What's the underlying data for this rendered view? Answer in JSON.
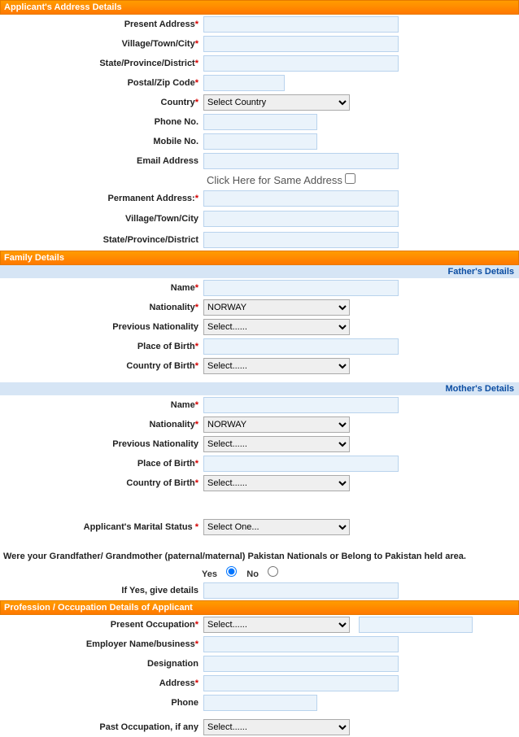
{
  "sections": {
    "address": {
      "header": "Applicant's Address Details",
      "present_address": "Present Address",
      "village": "Village/Town/City",
      "state": "State/Province/District",
      "postal": "Postal/Zip Code",
      "country": "Country",
      "phone": "Phone No.",
      "mobile": "Mobile No.",
      "email": "Email Address",
      "same_address_text": "Click Here for Same Address",
      "permanent_address": "Permanent Address:",
      "perm_village": "Village/Town/City",
      "perm_state": "State/Province/District",
      "country_selected": "Select Country"
    },
    "family": {
      "header": "Family Details",
      "fathers_details": "Father's Details",
      "mothers_details": "Mother's Details",
      "name": "Name",
      "nationality": "Nationality",
      "prev_nationality": "Previous Nationality",
      "place_of_birth": "Place of Birth",
      "country_of_birth": "Country of Birth",
      "nationality_selected": "NORWAY",
      "select_placeholder": "Select......"
    },
    "marital": {
      "label": "Applicant's Marital Status",
      "selected": "Select One..."
    },
    "pakistan": {
      "question": "Were your Grandfather/ Grandmother (paternal/maternal) Pakistan Nationals or Belong to Pakistan held area.",
      "yes": "Yes",
      "no": "No",
      "if_yes_details": "If Yes, give details"
    },
    "profession": {
      "header": "Profession / Occupation Details of Applicant",
      "present_occupation": "Present Occupation",
      "employer": "Employer Name/business",
      "designation": "Designation",
      "address": "Address",
      "phone": "Phone",
      "past_occupation": "Past Occupation, if any",
      "select_placeholder": "Select......"
    }
  },
  "req": "*"
}
